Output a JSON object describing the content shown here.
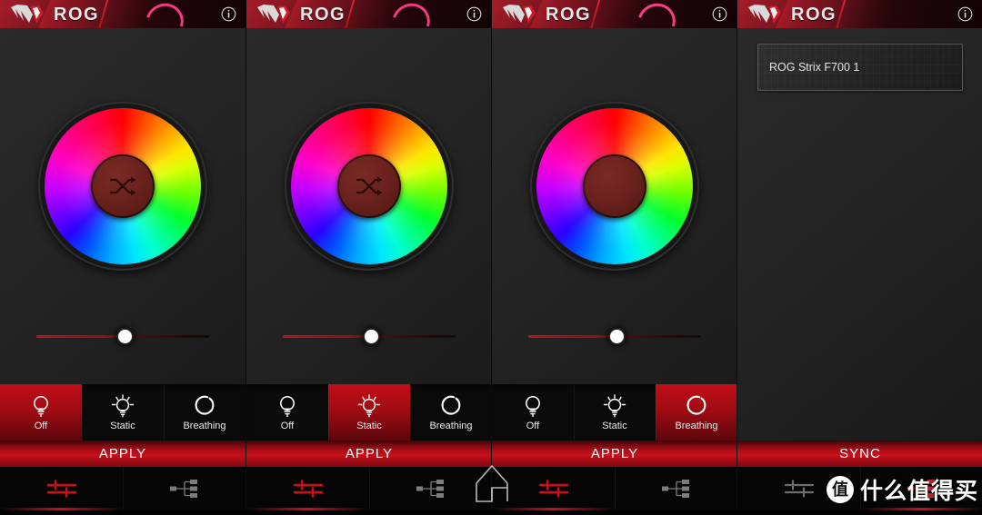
{
  "app": {
    "brand": "ROG",
    "logo_icon": "rog-eye-logo",
    "info_icon": "info-circle-icon",
    "accent_red": "#c8101a",
    "header_red": "#7d1520",
    "arc_pink": "#ff3d87",
    "hub_red": "#6b221d",
    "background": "#242424"
  },
  "modes": [
    {
      "label": "Off",
      "icon": "bulb-off-icon"
    },
    {
      "label": "Static",
      "icon": "bulb-static-icon"
    },
    {
      "label": "Breathing",
      "icon": "breathing-ring-icon"
    }
  ],
  "nav": [
    {
      "icon": "sliders-icon",
      "active": true
    },
    {
      "icon": "device-hub-icon",
      "active": false
    }
  ],
  "panels": [
    {
      "id": "panel-off",
      "active_mode": "Off",
      "active_mode_index": 0,
      "has_shuffle_hub": true,
      "shuffle_icon": "shuffle-icon",
      "slider_percent": 50,
      "primary_button": "APPLY",
      "arc_variant": "partial"
    },
    {
      "id": "panel-static",
      "active_mode": "Static",
      "active_mode_index": 1,
      "has_shuffle_hub": true,
      "shuffle_icon": "shuffle-icon",
      "slider_percent": 50,
      "primary_button": "APPLY",
      "arc_variant": "partial"
    },
    {
      "id": "panel-breathing",
      "active_mode": "Breathing",
      "active_mode_index": 2,
      "has_shuffle_hub": false,
      "shuffle_icon": "",
      "slider_percent": 50,
      "primary_button": "APPLY",
      "arc_variant": "full"
    },
    {
      "id": "panel-devices",
      "active_mode": "",
      "active_mode_index": -1,
      "has_shuffle_hub": false,
      "shuffle_icon": "",
      "slider_percent": 0,
      "primary_button": "SYNC",
      "arc_variant": "none",
      "devices": [
        {
          "name": "ROG Strix F700 1"
        }
      ]
    }
  ],
  "home_button": {
    "icon": "home-outline-icon"
  },
  "watermark": {
    "badge": "值",
    "text": "什么值得买"
  }
}
